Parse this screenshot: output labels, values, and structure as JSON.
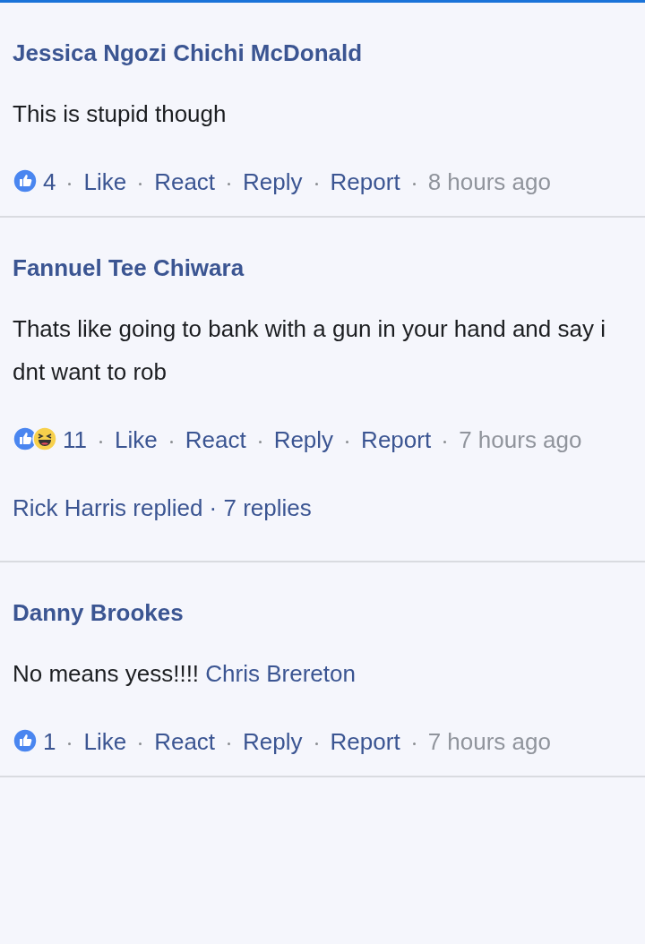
{
  "comments": [
    {
      "author": "Jessica Ngozi Chichi McDonald",
      "text": "This is stupid though",
      "reactions": [
        {
          "kind": "like"
        }
      ],
      "reaction_count": "4",
      "actions": [
        "Like",
        "React",
        "Reply",
        "Report"
      ],
      "time": "8 hours ago"
    },
    {
      "author": "Fannuel Tee Chiwara",
      "text": "Thats like going to bank with a gun in your hand and say i dnt want to rob",
      "reactions": [
        {
          "kind": "like"
        },
        {
          "kind": "haha"
        }
      ],
      "reaction_count": "11",
      "actions": [
        "Like",
        "React",
        "Reply",
        "Report"
      ],
      "time": "7 hours ago",
      "replies_summary": "Rick Harris replied · 7 replies"
    },
    {
      "author": "Danny Brookes",
      "text": "No means yess!!!!",
      "mention": "Chris Brereton",
      "reactions": [
        {
          "kind": "like"
        }
      ],
      "reaction_count": "1",
      "actions": [
        "Like",
        "React",
        "Reply",
        "Report"
      ],
      "time": "7 hours ago"
    }
  ]
}
